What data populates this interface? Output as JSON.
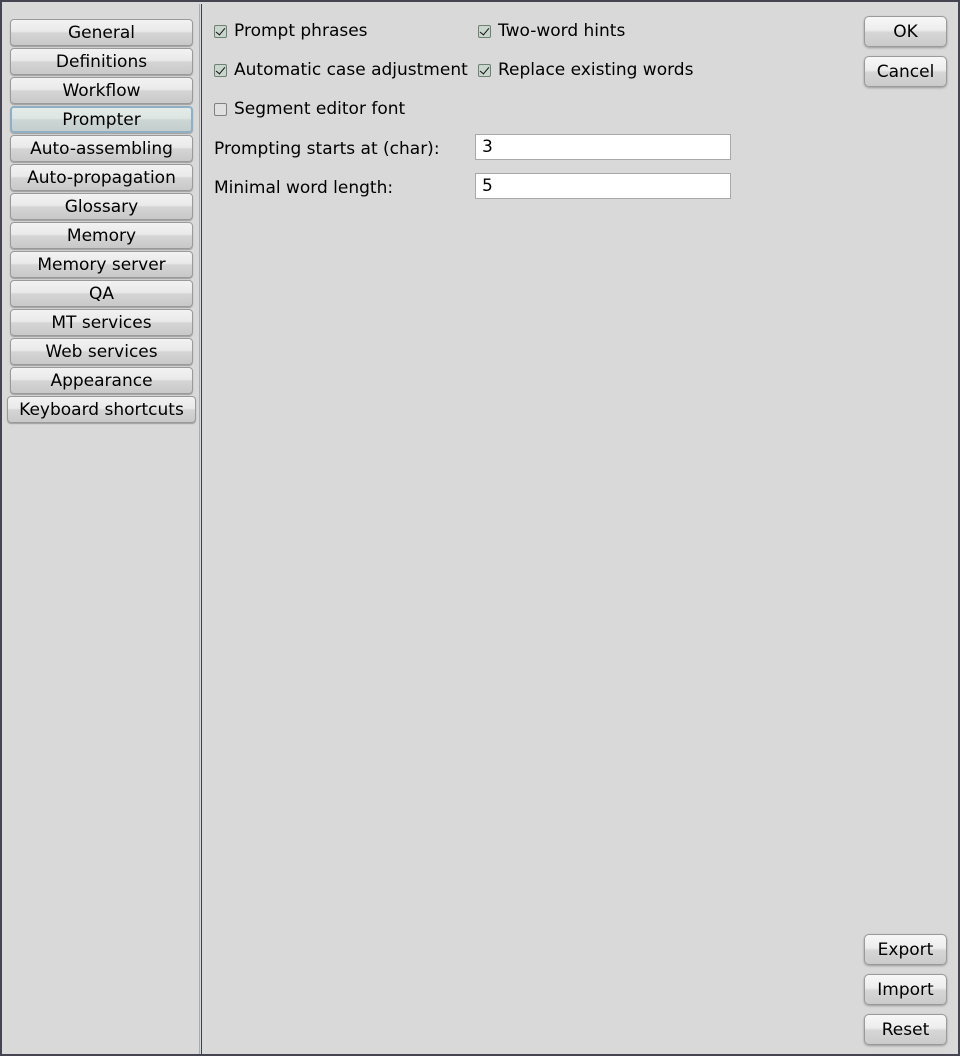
{
  "window": {
    "background_color": "#d9d9d9",
    "border_color": "#454552"
  },
  "sidebar": {
    "selected": "Prompter",
    "items": [
      {
        "label": "General"
      },
      {
        "label": "Definitions"
      },
      {
        "label": "Workflow"
      },
      {
        "label": "Prompter"
      },
      {
        "label": "Auto-assembling"
      },
      {
        "label": "Auto-propagation"
      },
      {
        "label": "Glossary"
      },
      {
        "label": "Memory"
      },
      {
        "label": "Memory server"
      },
      {
        "label": "QA"
      },
      {
        "label": "MT services"
      },
      {
        "label": "Web services"
      },
      {
        "label": "Appearance"
      },
      {
        "label": "Keyboard shortcuts"
      }
    ]
  },
  "main": {
    "checkboxes": [
      {
        "label": "Prompt phrases",
        "checked": true
      },
      {
        "label": "Two-word hints",
        "checked": true
      },
      {
        "label": "Automatic case adjustment",
        "checked": true
      },
      {
        "label": "Replace existing words",
        "checked": true
      },
      {
        "label": "Segment editor font",
        "checked": false
      }
    ],
    "fields": [
      {
        "label": "Prompting starts at (char):",
        "value": "3"
      },
      {
        "label": "Minimal word length:",
        "value": "5"
      }
    ]
  },
  "buttons": {
    "ok": "OK",
    "cancel": "Cancel",
    "export": "Export",
    "import": "Import",
    "reset": "Reset"
  }
}
